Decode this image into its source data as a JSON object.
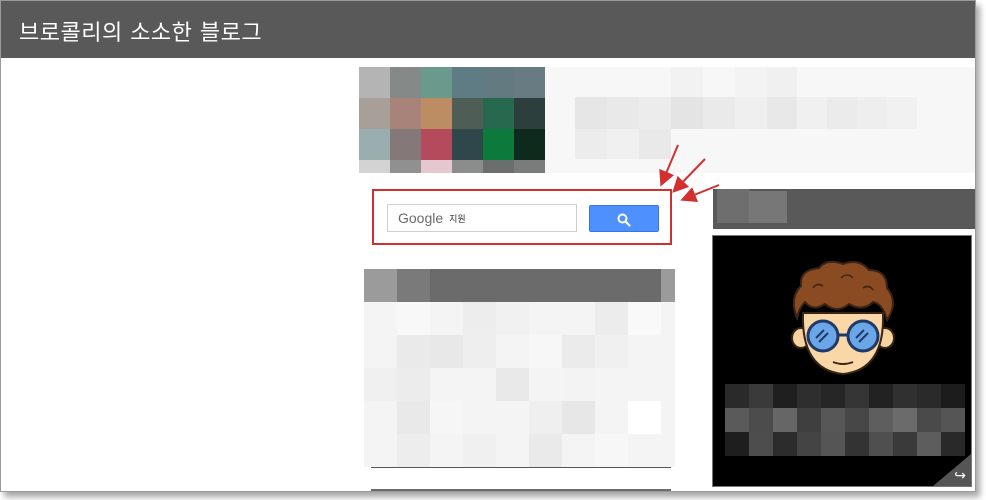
{
  "blog": {
    "title": "브로콜리의 소소한 블로그"
  },
  "search": {
    "brand": "Google",
    "query": "지원",
    "button_icon": "search-icon"
  },
  "annotations": {
    "arrow_color": "#d32f2f",
    "highlight_color": "#d32f2f"
  },
  "colors": {
    "header_bg": "#595959",
    "search_button": "#4d90fe"
  }
}
